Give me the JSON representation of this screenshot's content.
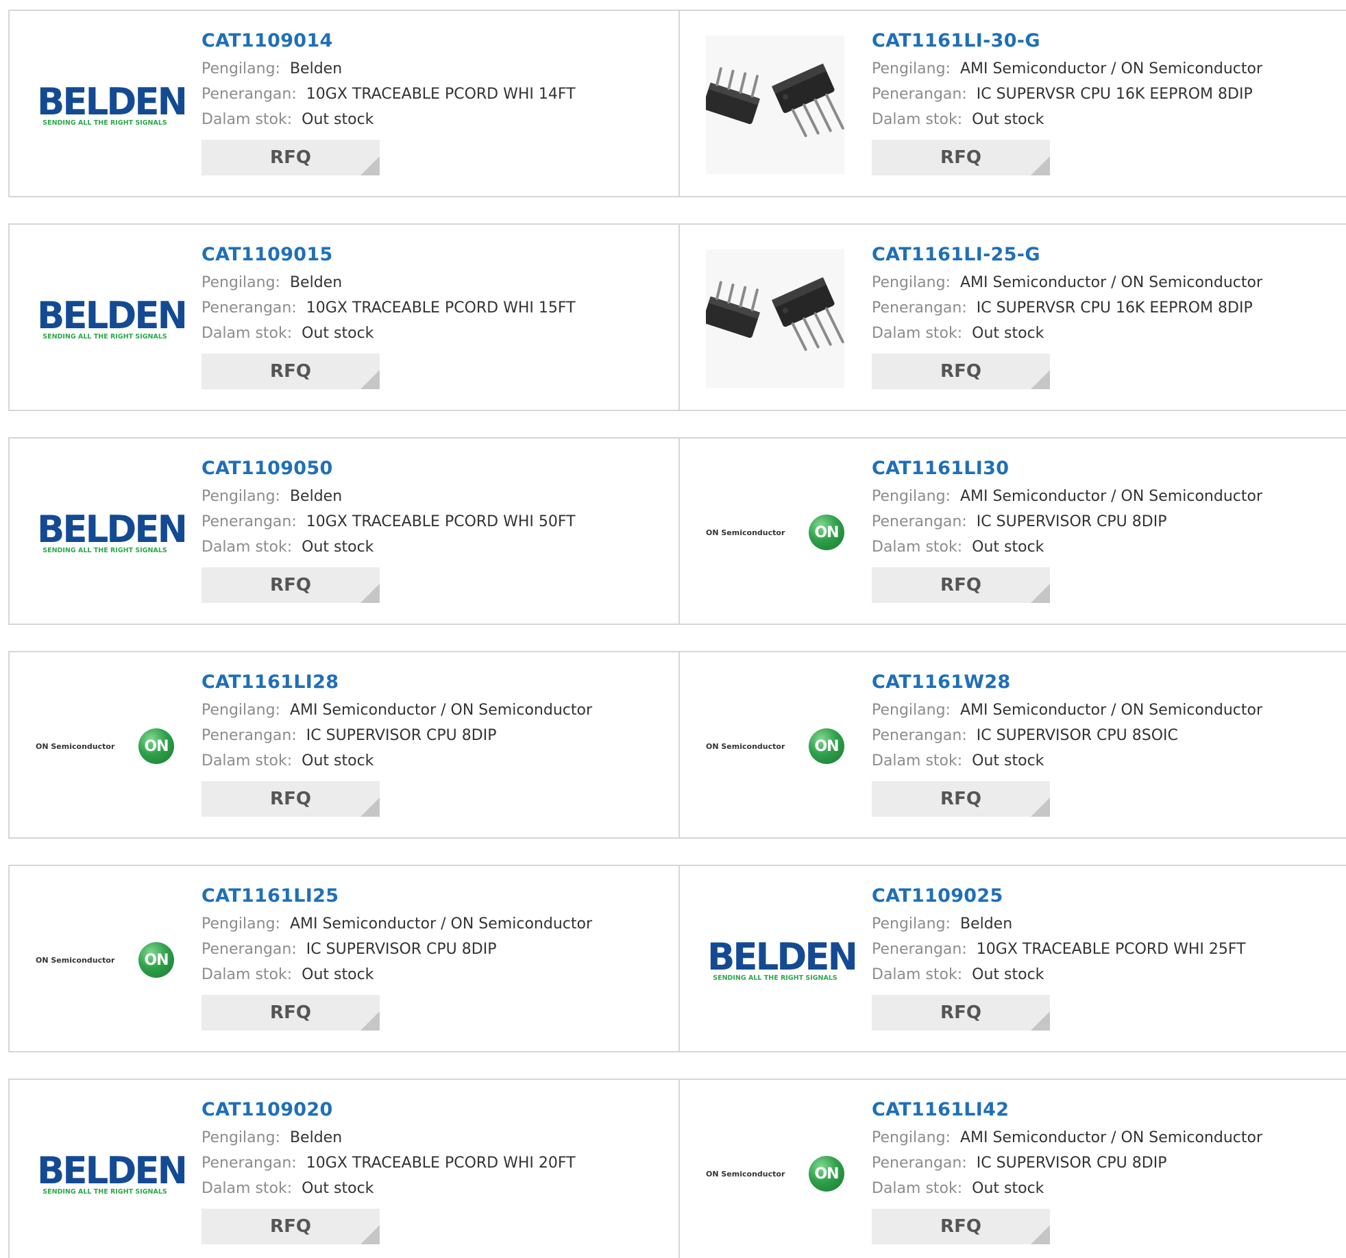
{
  "labels": {
    "manufacturer": "Pengilang:",
    "description": "Penerangan:",
    "stock": "Dalam stok:",
    "rfq": "RFQ"
  },
  "logos": {
    "belden_word": "BELDEN",
    "belden_tag": "SENDING ALL THE RIGHT SIGNALS",
    "onsemi_text": "ON Semiconductor",
    "onsemi_mark": "ON"
  },
  "colors": {
    "part_link": "#1f6fb8",
    "belden_blue": "#134a93",
    "belden_green": "#2ea84b",
    "onsemi_green": "#2ea04a",
    "rfq_bg": "#ececec"
  },
  "products": [
    {
      "part": "CAT1109014",
      "manufacturer": "Belden",
      "description": "10GX TRACEABLE PCORD WHI 14FT",
      "stock": "Out stock",
      "image": "belden-logo"
    },
    {
      "part": "CAT1161LI-30-G",
      "manufacturer": "AMI Semiconductor / ON Semiconductor",
      "description": "IC SUPERVSR CPU 16K EEPROM 8DIP",
      "stock": "Out stock",
      "image": "dip-chip-photo"
    },
    {
      "part": "CAT1109015",
      "manufacturer": "Belden",
      "description": "10GX TRACEABLE PCORD WHI 15FT",
      "stock": "Out stock",
      "image": "belden-logo"
    },
    {
      "part": "CAT1161LI-25-G",
      "manufacturer": "AMI Semiconductor / ON Semiconductor",
      "description": "IC SUPERVSR CPU 16K EEPROM 8DIP",
      "stock": "Out stock",
      "image": "dip-chip-photo"
    },
    {
      "part": "CAT1109050",
      "manufacturer": "Belden",
      "description": "10GX TRACEABLE PCORD WHI 50FT",
      "stock": "Out stock",
      "image": "belden-logo"
    },
    {
      "part": "CAT1161LI30",
      "manufacturer": "AMI Semiconductor / ON Semiconductor",
      "description": "IC SUPERVISOR CPU 8DIP",
      "stock": "Out stock",
      "image": "onsemi-logo"
    },
    {
      "part": "CAT1161LI28",
      "manufacturer": "AMI Semiconductor / ON Semiconductor",
      "description": "IC SUPERVISOR CPU 8DIP",
      "stock": "Out stock",
      "image": "onsemi-logo"
    },
    {
      "part": "CAT1161W28",
      "manufacturer": "AMI Semiconductor / ON Semiconductor",
      "description": "IC SUPERVISOR CPU 8SOIC",
      "stock": "Out stock",
      "image": "onsemi-logo"
    },
    {
      "part": "CAT1161LI25",
      "manufacturer": "AMI Semiconductor / ON Semiconductor",
      "description": "IC SUPERVISOR CPU 8DIP",
      "stock": "Out stock",
      "image": "onsemi-logo"
    },
    {
      "part": "CAT1109025",
      "manufacturer": "Belden",
      "description": "10GX TRACEABLE PCORD WHI 25FT",
      "stock": "Out stock",
      "image": "belden-logo"
    },
    {
      "part": "CAT1109020",
      "manufacturer": "Belden",
      "description": "10GX TRACEABLE PCORD WHI 20FT",
      "stock": "Out stock",
      "image": "belden-logo"
    },
    {
      "part": "CAT1161LI42",
      "manufacturer": "AMI Semiconductor / ON Semiconductor",
      "description": "IC SUPERVISOR CPU 8DIP",
      "stock": "Out stock",
      "image": "onsemi-logo"
    }
  ]
}
